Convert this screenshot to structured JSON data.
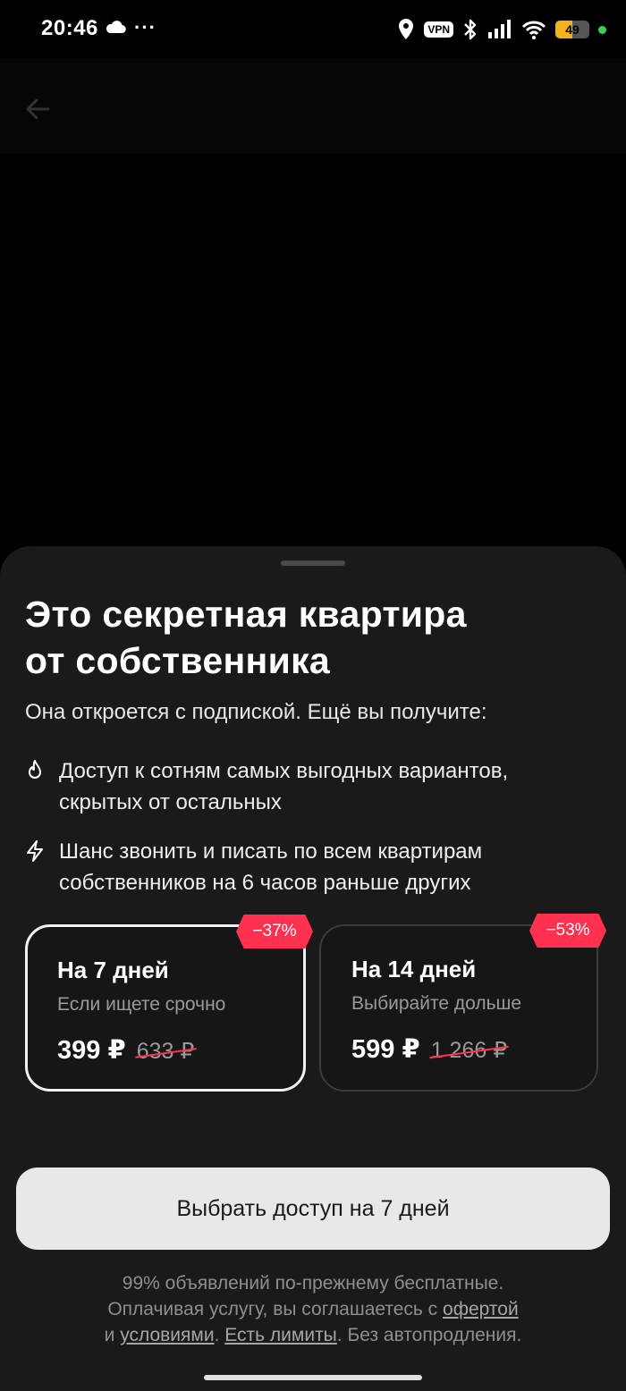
{
  "status_bar": {
    "time": "20:46",
    "dots": "···",
    "vpn": "VPN",
    "battery_level": "49",
    "battery_fraction": 0.49,
    "colors": {
      "battery": "#f2b21a",
      "charging": "#39d353"
    }
  },
  "header": {
    "back_icon": "arrow-left-icon"
  },
  "sheet": {
    "title_line1": "Это секретная квартира",
    "title_line2": "от собственника",
    "subtitle": "Она откроется с подпиской. Ещё вы получите:",
    "features": [
      {
        "icon": "fire-icon",
        "line1": "Доступ к сотням самых выгодных вариантов,",
        "line2": "скрытых от остальных"
      },
      {
        "icon": "lightning-icon",
        "line1": "Шанс звонить и писать по всем квартирам",
        "line2": "собственников на 6 часов раньше других"
      }
    ],
    "plans": [
      {
        "title": "На 7 дней",
        "subtitle": "Если ищете срочно",
        "price": "399 ₽",
        "old_price": "633 ₽",
        "discount": "−37%",
        "selected": true
      },
      {
        "title": "На 14 дней",
        "subtitle": "Выбирайте дольше",
        "price": "599 ₽",
        "old_price": "1 266 ₽",
        "discount": "−53%",
        "selected": false
      }
    ],
    "cta_label": "Выбрать доступ на 7 дней",
    "legal": {
      "line1": "99% объявлений по-прежнему бесплатные.",
      "line2_prefix": "Оплачивая услугу, вы соглашаетесь с ",
      "offer_link": "офертой",
      "line3_prefix": "и ",
      "terms_link": "условиями",
      "line3_sep": ". ",
      "limits_link": "Есть лимиты",
      "line3_suffix": ". Без автопродления."
    },
    "colors": {
      "discount": "#ff3050",
      "strike": "#ff3355"
    }
  }
}
